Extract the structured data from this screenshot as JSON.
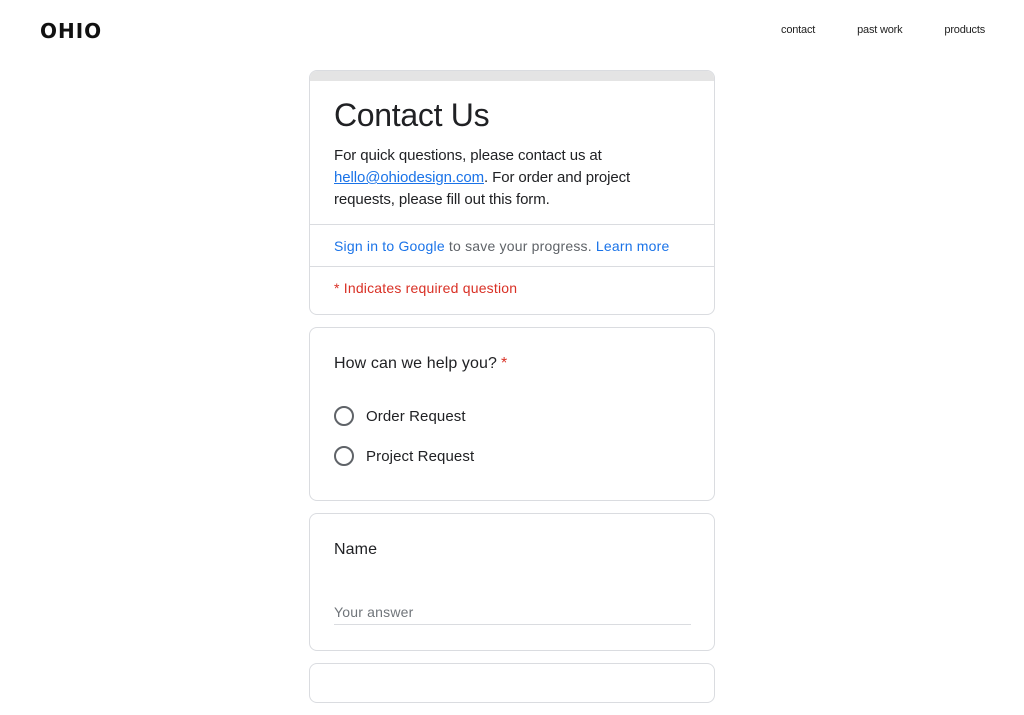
{
  "header": {
    "logo": "OHIO",
    "nav": [
      "contact",
      "past work",
      "products"
    ]
  },
  "form": {
    "title": "Contact Us",
    "desc_before": "For quick questions, please contact us at ",
    "email": "hello@ohiodesign.com",
    "desc_after": ". For order and project requests, please fill out this form.",
    "signin_link": "Sign in to Google",
    "signin_text": " to save your progress. ",
    "learn_more": "Learn more",
    "required_note": "* Indicates required question"
  },
  "question_help": {
    "title": "How can we help you?",
    "required_mark": "*",
    "options": [
      "Order Request",
      "Project Request"
    ]
  },
  "question_name": {
    "title": "Name",
    "placeholder": "Your answer"
  },
  "colors": {
    "accent": "#1a73e8",
    "required": "#d93025",
    "border": "#dadce0"
  }
}
